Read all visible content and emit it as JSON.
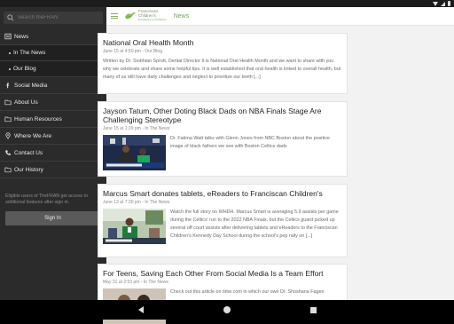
{
  "drawer": {
    "search_placeholder": "Search theFRAN",
    "items": [
      {
        "label": "News",
        "icon": "newspaper-icon"
      },
      {
        "label": "In The News",
        "sub": true
      },
      {
        "label": "Our Blog",
        "sub": true
      },
      {
        "label": "Social Media",
        "icon": "facebook-icon"
      },
      {
        "label": "About Us",
        "icon": "folder-icon"
      },
      {
        "label": "Human Resources",
        "icon": "folder-icon"
      },
      {
        "label": "Where We Are",
        "icon": "pin-icon"
      },
      {
        "label": "Contact Us",
        "icon": "phone-icon"
      },
      {
        "label": "Our History",
        "icon": "folder-icon"
      }
    ],
    "guest_note": "Eligible users of TheFRAN get access to additional features after sign in.",
    "signin_label": "Sign In"
  },
  "header": {
    "logo_line1": "Franciscan",
    "logo_line2": "Children's",
    "logo_line3": "Excellence in Pediatrics",
    "title": "News"
  },
  "articles": [
    {
      "title": "National Oral Health Month",
      "meta": "June 15 at 4:50 pm - Our Blog",
      "excerpt": "Written by Dr. Siobhian Sprott, Dental Director It is National Oral Health Month and we want to share with you why we celebrate and share some helpful tips. It is well established that oral health is linked to overall health, but many of us still have daily challenges and neglect to prioritize our teeth [...]"
    },
    {
      "title": "Jayson Tatum, Other Doting Black Dads on NBA Finals Stage Are Challenging Stereotype",
      "meta": "June 15 at 1:29 pm - In The News",
      "excerpt": "Dr. Fatima Watt talks with Glenn Jones from NBC Boston about the positive image of black fathers we see with Boston Celtics dads"
    },
    {
      "title": "Marcus Smart donates tablets, eReaders to Franciscan Children's",
      "meta": "June 13 at 7:30 pm - In The News",
      "excerpt": "Watch the full story on WHDH. Marcus Smart is averaging 5.9 assists per game during the Celtics' run to the 2022 NBA Finals, but the Celtics guard picked up several off court assists after delivering tablets and eReaders to the Franciscan Children's Kennedy Day School during the school's pep rally on [...]"
    },
    {
      "title": "For Teens, Saving Each Other From Social Media Is a Team Effort",
      "meta": "May 31 at 2:53 pm - In The News",
      "excerpt": "Check out this article on time.com in which our own Dr. Shoshana Fagen"
    }
  ]
}
